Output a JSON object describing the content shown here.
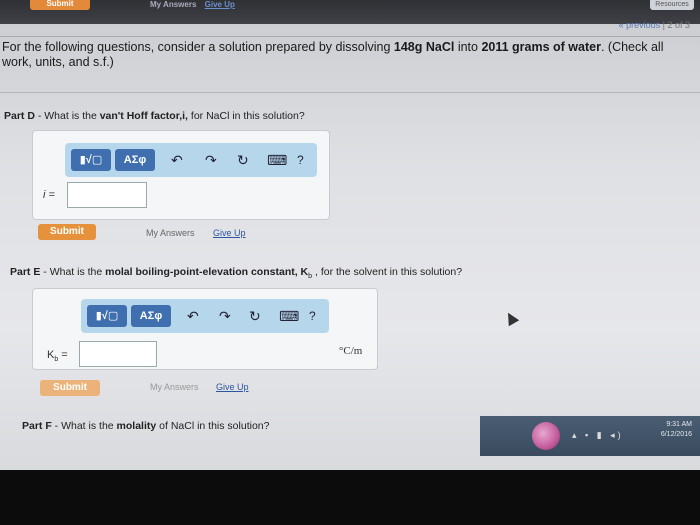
{
  "top": {
    "submit_label": "Submit",
    "my_answers_label": "My Answers",
    "give_up_label": "Give Up",
    "resources_label": "Resources",
    "previous_label": "« previous",
    "page_indicator": "2 of 3"
  },
  "intro": {
    "text_before": "For the following questions, consider a solution prepared by dissolving ",
    "amount_nacl": "148g NaCl",
    "text_middle": " into ",
    "amount_water": "2011 grams of water",
    "text_after": ". (Check all work, units, and s.f.)"
  },
  "part_d": {
    "label": "Part D",
    "question_before": " - What is the ",
    "question_bold": "van't Hoff factor,i,",
    "question_after": " for NaCl in this solution?",
    "input_label": "i =",
    "submit_label": "Submit",
    "my_answers_label": "My Answers",
    "give_up_label": "Give Up"
  },
  "part_e": {
    "label": "Part E",
    "question_before": " - What is the ",
    "question_bold": "molal boiling-point-elevation constant, K",
    "question_sub": "b",
    "question_after": " , for the solvent in this solution?",
    "input_label": "K",
    "input_label_sub": "b",
    "input_label_eq": " =",
    "unit": "°C/m",
    "submit_label": "Submit",
    "my_answers_label": "My Answers",
    "give_up_label": "Give Up"
  },
  "part_f": {
    "label": "Part F",
    "question_before": " - What is the ",
    "question_bold": "molality",
    "question_after": " of NaCl in this solution?"
  },
  "toolbar": {
    "template_btn": "▮√▢",
    "greek_btn": "ΑΣφ",
    "undo_icon": "↶",
    "redo_icon": "↷",
    "reset_icon": "↻",
    "keyboard_icon": "⌨",
    "help_icon": "?"
  },
  "taskbar": {
    "time": "9:31 AM",
    "date": "6/12/2016"
  }
}
